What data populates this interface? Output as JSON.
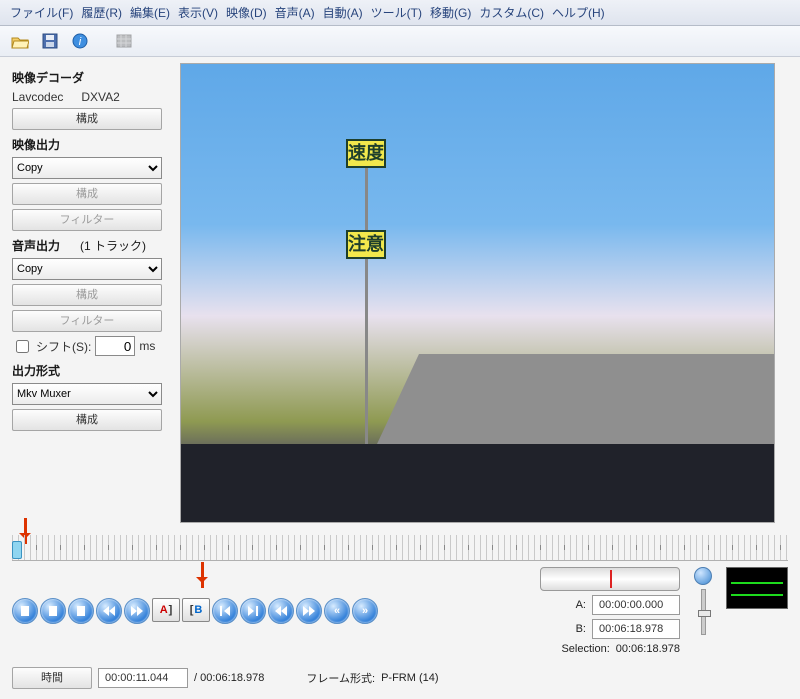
{
  "menu": {
    "file": "ファイル(F)",
    "history": "履歴(R)",
    "edit": "編集(E)",
    "view": "表示(V)",
    "video": "映像(D)",
    "audio": "音声(A)",
    "auto": "自動(A)",
    "tools": "ツール(T)",
    "go": "移動(G)",
    "custom": "カスタム(C)",
    "help": "ヘルプ(H)"
  },
  "sidebar": {
    "decoder_title": "映像デコーダ",
    "decoder_name": "Lavcodec",
    "decoder_mode": "DXVA2",
    "configure": "構成",
    "video_out_title": "映像出力",
    "video_out_value": "Copy",
    "filter": "フィルター",
    "audio_out_title": "音声出力",
    "audio_tracks": "(1 トラック)",
    "audio_out_value": "Copy",
    "shift_label": "シフト(S):",
    "shift_value": "0",
    "shift_unit": "ms",
    "output_fmt_title": "出力形式",
    "output_fmt_value": "Mkv Muxer"
  },
  "sign": {
    "top": "速度",
    "bottom": "注意"
  },
  "timebar": {
    "time_button": "時間",
    "current": "00:00:11.044",
    "total": "/ 00:06:18.978",
    "frame_label": "フレーム形式:",
    "frame_value": "P-FRM (14)"
  },
  "ab": {
    "a_label": "A:",
    "a_value": "00:00:00.000",
    "b_label": "B:",
    "b_value": "00:06:18.978",
    "sel_label": "Selection:",
    "sel_value": "00:06:18.978"
  },
  "marks": {
    "a": "A",
    "b": "B"
  }
}
